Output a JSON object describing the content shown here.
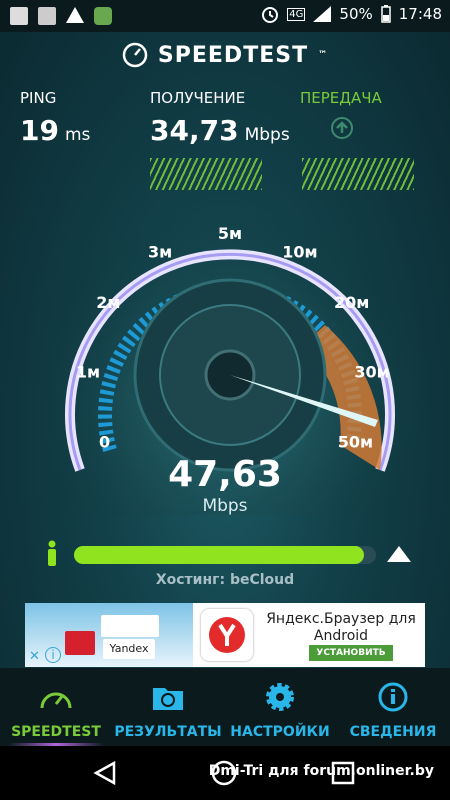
{
  "status": {
    "network": "4G",
    "battery": "50%",
    "time": "17:48"
  },
  "app": {
    "title": "SPEEDTEST"
  },
  "metrics": {
    "ping": {
      "label": "PING",
      "value": "19",
      "unit": "ms"
    },
    "download": {
      "label": "ПОЛУЧЕНИЕ",
      "value": "34,73",
      "unit": "Mbps"
    },
    "upload": {
      "label": "ПЕРЕДАЧА"
    }
  },
  "gauge": {
    "ticks": [
      "0",
      "1м",
      "2м",
      "3м",
      "5м",
      "10м",
      "20м",
      "30м",
      "50м"
    ],
    "current_value": "47,63",
    "unit": "Mbps"
  },
  "progress": {
    "fraction": 0.96
  },
  "hosting": "Хостинг: beCloud",
  "ad": {
    "title": "Яндекс.Браузер для Android",
    "button": "УСТАНОВИТЬ",
    "image_label": "Yandex"
  },
  "nav": {
    "speedtest": "SPEEDTEST",
    "results": "РЕЗУЛЬТАТЫ",
    "settings": "НАСТРОЙКИ",
    "info": "СВЕДЕНИЯ"
  },
  "watermark": "Dmi-Tri для forum.onliner.by",
  "colors": {
    "accent": "#7acb3a",
    "upload": "#7acb3a",
    "nav_active": "#7acb3a",
    "nav_inactive": "#29b6e8",
    "progress": "#8fe31f"
  }
}
